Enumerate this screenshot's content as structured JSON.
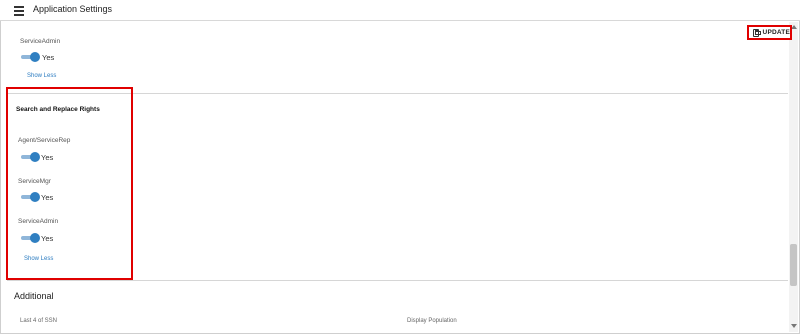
{
  "app_bar": {
    "title": "Application Settings"
  },
  "toolbar": {
    "update_label": "UPDATE"
  },
  "previous_section": {
    "field_label": "ServiceAdmin",
    "toggle_value": "Yes",
    "show_less": "Show Less"
  },
  "search_replace_section": {
    "title": "Search and Replace Rights",
    "fields": [
      {
        "label": "Agent/ServiceRep",
        "value": "Yes"
      },
      {
        "label": "ServiceMgr",
        "value": "Yes"
      },
      {
        "label": "ServiceAdmin",
        "value": "Yes"
      }
    ],
    "show_less": "Show Less"
  },
  "additional_section": {
    "title": "Additional",
    "left_label": "Last 4 of SSN",
    "right_label": "Display Population"
  },
  "colors": {
    "toggle_on": "#2f7fc1",
    "toggle_track": "#8fb6d9",
    "link": "#2a7bc0",
    "highlight": "#e00000"
  }
}
